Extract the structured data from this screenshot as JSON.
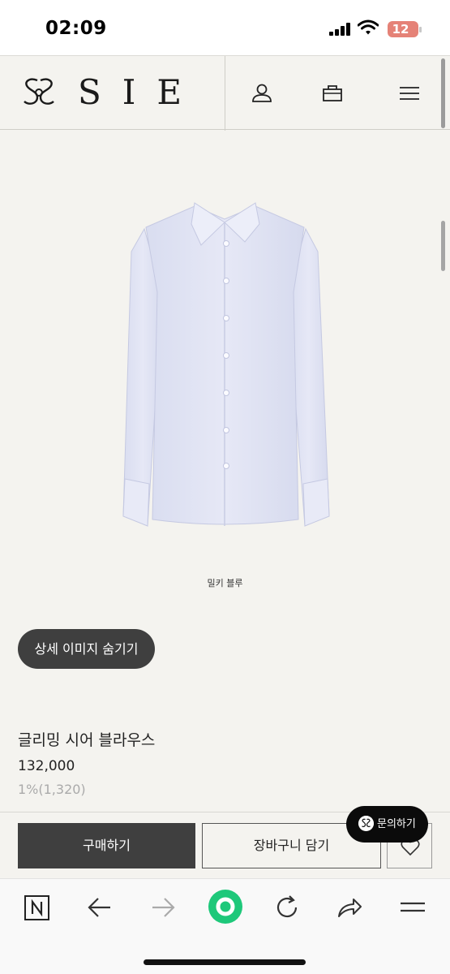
{
  "status_bar": {
    "time": "02:09",
    "battery": "12"
  },
  "header": {
    "brand_name": "SIE",
    "icons": [
      "user-icon",
      "bag-icon",
      "menu-icon"
    ]
  },
  "product": {
    "image_icon": "blouse-image",
    "color_caption": "밀키 블루",
    "toggle_detail_label": "상세 이미지 숨기기",
    "title": "글리밍 시어 블라우스",
    "price": "132,000",
    "points": "1%(1,320)"
  },
  "actions": {
    "buy_label": "구매하기",
    "cart_label": "장바구니 담기",
    "wish_icon": "heart-icon"
  },
  "inquiry": {
    "label": "문의하기"
  },
  "browser": {
    "icons": [
      "naver-icon",
      "back-icon",
      "forward-icon",
      "home-circle-icon",
      "reload-icon",
      "share-icon",
      "menu-icon"
    ]
  },
  "colors": {
    "background": "#f4f3ef",
    "dark_button": "#3f3f3f",
    "accent_green": "#1ec87a",
    "battery": "#e58277"
  }
}
